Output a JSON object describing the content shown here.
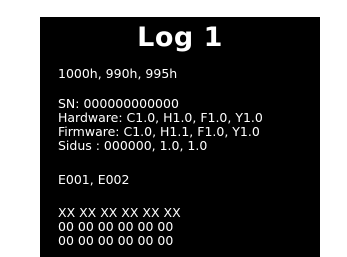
{
  "log": {
    "title": "Log 1",
    "hours": "1000h, 990h, 995h",
    "sn": "SN: 000000000000",
    "hardware": "Hardware: C1.0, H1.0, F1.0, Y1.0",
    "firmware": "Firmware: C1.0, H1.1, F1.0, Y1.0",
    "sidus": "Sidus : 000000, 1.0, 1.0",
    "errors": "E001, E002",
    "data_rows": [
      "XX XX XX XX XX XX",
      "00 00 00 00 00 00",
      "00 00 00 00 00 00"
    ]
  },
  "colors": {
    "screen_background": "#000000",
    "text": "#ffffff",
    "page_background": "#ffffff"
  }
}
